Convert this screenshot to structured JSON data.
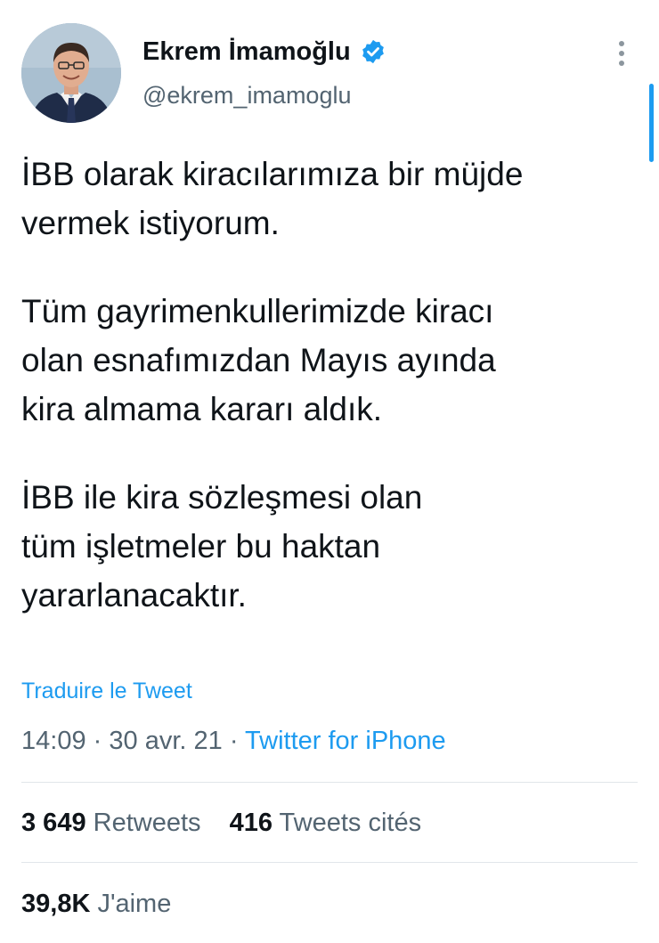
{
  "author": {
    "display_name": "Ekrem İmamoğlu",
    "handle": "@ekrem_imamoglu",
    "verified": true,
    "avatar": "profile-photo"
  },
  "tweet": {
    "lines": [
      "İBB olarak kiracılarımıza bir müjde",
      "vermek istiyorum.",
      "",
      "Tüm gayrimenkullerimizde kiracı",
      "olan esnafımızdan Mayıs ayında",
      "kira almama kararı aldık.",
      "",
      "İBB ile kira sözleşmesi olan",
      "tüm işletmeler bu haktan",
      "yararlanacaktır."
    ],
    "translate_label": "Traduire le Tweet",
    "time": "14:09",
    "date": "30 avr. 21",
    "separator": "·",
    "source": "Twitter for iPhone"
  },
  "stats": {
    "retweets_count": "3 649",
    "retweets_label": "Retweets",
    "quotes_count": "416",
    "quotes_label": "Tweets cités",
    "likes_count": "39,8K",
    "likes_label": "J'aime"
  },
  "icons": {
    "verified": "verified-badge-icon",
    "more": "more-vertical-icon"
  },
  "colors": {
    "accent": "#1d9bf0",
    "text": "#0f1419",
    "secondary": "#536471",
    "divider": "#e1e6ea"
  }
}
